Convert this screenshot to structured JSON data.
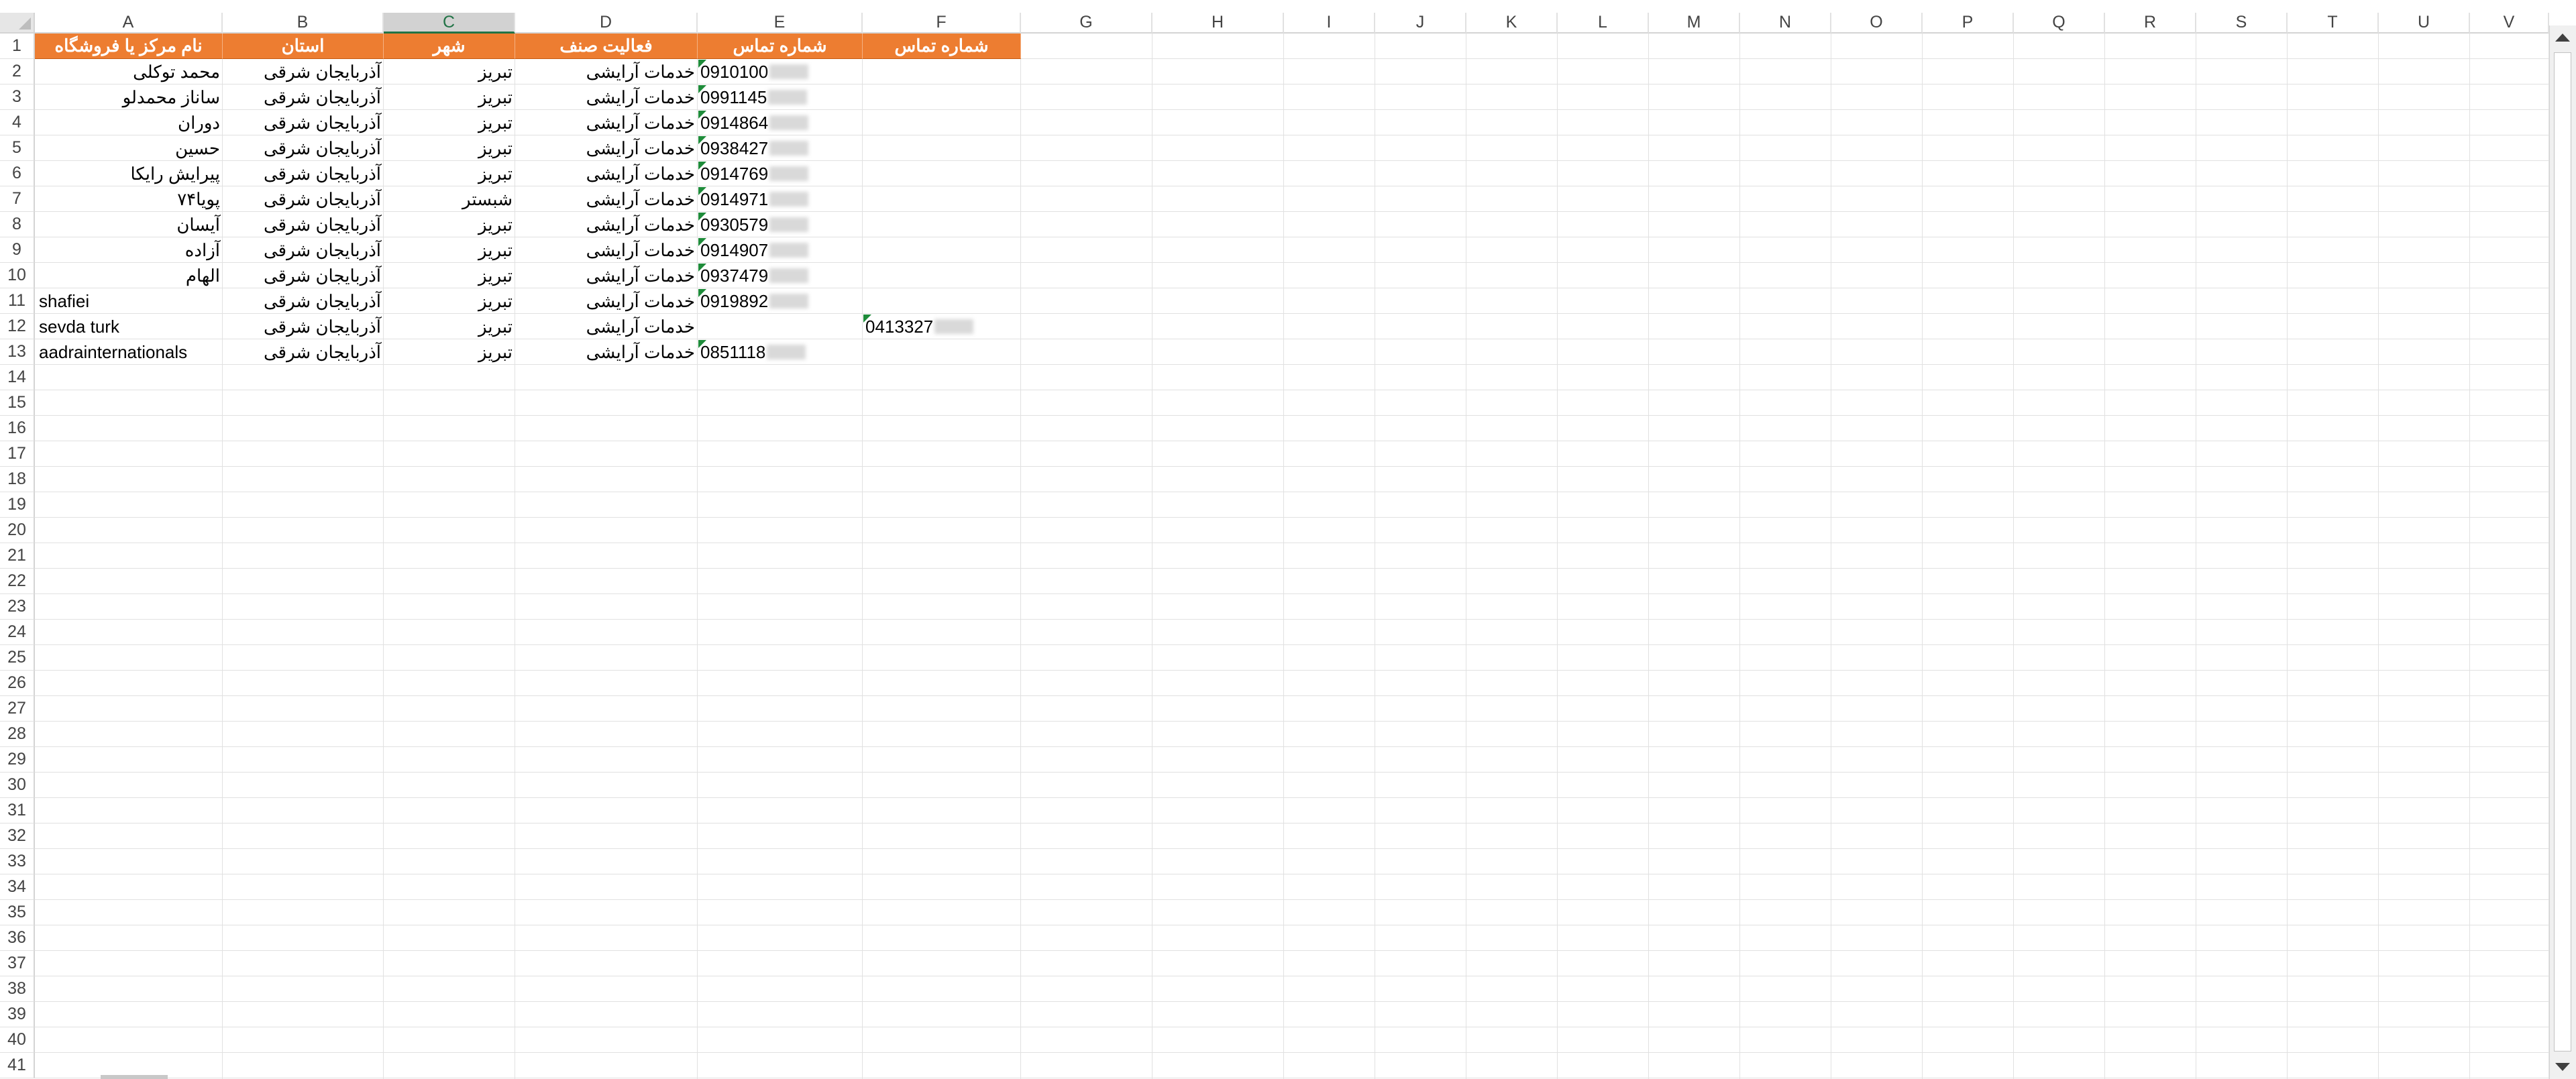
{
  "columns": [
    "A",
    "B",
    "C",
    "D",
    "E",
    "F",
    "G",
    "H",
    "I",
    "J",
    "K",
    "L",
    "M",
    "N",
    "O",
    "P",
    "Q",
    "R",
    "S",
    "T",
    "U",
    "V"
  ],
  "selected_column": "C",
  "rows": [
    "1",
    "2",
    "3",
    "4",
    "5",
    "6",
    "7",
    "8",
    "9",
    "10",
    "11",
    "12",
    "13",
    "14",
    "15",
    "16",
    "17",
    "18",
    "19",
    "20",
    "21",
    "22",
    "23",
    "24",
    "25",
    "26",
    "27",
    "28",
    "29",
    "30",
    "31",
    "32",
    "33",
    "34",
    "35",
    "36",
    "37",
    "38",
    "39",
    "40",
    "41"
  ],
  "header_row": {
    "A": "نام مرکز یا فروشگاه",
    "B": "استان",
    "C": "شهر",
    "D": "فعالیت صنف",
    "E": "شماره تماس",
    "F": "شماره تماس"
  },
  "header_fill_color": "#ed7d31",
  "data_rows": [
    {
      "A": "محمد توکلی",
      "B": "آذربایجان شرقی",
      "C": "تبریز",
      "D": "خدمات آرایشی",
      "E": "0910100",
      "F": ""
    },
    {
      "A": "ساناز محمدلو",
      "B": "آذربایجان شرقی",
      "C": "تبریز",
      "D": "خدمات آرایشی",
      "E": "0991145",
      "F": ""
    },
    {
      "A": "دوران",
      "B": "آذربایجان شرقی",
      "C": "تبریز",
      "D": "خدمات آرایشی",
      "E": "0914864",
      "F": ""
    },
    {
      "A": "حسین",
      "B": "آذربایجان شرقی",
      "C": "تبریز",
      "D": "خدمات آرایشی",
      "E": "0938427",
      "F": ""
    },
    {
      "A": "پیرایش رایکا",
      "B": "آذربایجان شرقی",
      "C": "تبریز",
      "D": "خدمات آرایشی",
      "E": "0914769",
      "F": ""
    },
    {
      "A": "پویا۷۴",
      "B": "آذربایجان شرقی",
      "C": "شبستر",
      "D": "خدمات آرایشی",
      "E": "0914971",
      "F": ""
    },
    {
      "A": "آیسان",
      "B": "آذربایجان شرقی",
      "C": "تبریز",
      "D": "خدمات آرایشی",
      "E": "0930579",
      "F": ""
    },
    {
      "A": "آزاده",
      "B": "آذربایجان شرقی",
      "C": "تبریز",
      "D": "خدمات آرایشی",
      "E": "0914907",
      "F": ""
    },
    {
      "A": "الهام",
      "B": "آذربایجان شرقی",
      "C": "تبریز",
      "D": "خدمات آرایشی",
      "E": "0937479",
      "F": ""
    },
    {
      "A": "shafiei",
      "B": "آذربایجان شرقی",
      "C": "تبریز",
      "D": "خدمات آرایشی",
      "E": "0919892",
      "F": ""
    },
    {
      "A": "sevda turk",
      "B": "آذربایجان شرقی",
      "C": "تبریز",
      "D": "خدمات آرایشی",
      "E": "",
      "F": "0413327"
    },
    {
      "A": "aadrainternationals",
      "B": "آذربایجان شرقی",
      "C": "تبریز",
      "D": "خدمات آرایشی",
      "E": "0851118",
      "F": ""
    }
  ]
}
